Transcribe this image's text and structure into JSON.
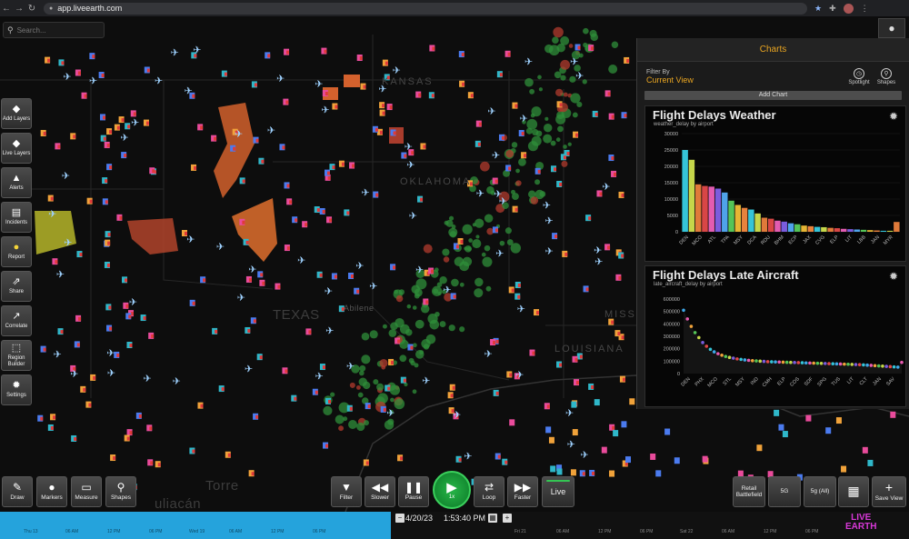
{
  "browser": {
    "url": "app.liveearth.com"
  },
  "search": {
    "placeholder": "Search..."
  },
  "map_labels": [
    "KANSAS",
    "OKLAHOMA",
    "TEXAS",
    "MISS",
    "LOUISIANA",
    "Torre",
    "uliacán",
    "Abilene"
  ],
  "sidebar": {
    "items": [
      {
        "label": "Add Layers",
        "icon": "layers-icon"
      },
      {
        "label": "Live Layers",
        "icon": "live-layers-icon"
      },
      {
        "label": "Alerts",
        "icon": "alert-icon"
      },
      {
        "label": "Incidents",
        "icon": "incidents-icon"
      },
      {
        "label": "Report",
        "icon": "report-pin-icon"
      },
      {
        "label": "Share",
        "icon": "share-icon"
      },
      {
        "label": "Correlate",
        "icon": "correlate-icon"
      },
      {
        "label": "Region Builder",
        "icon": "region-builder-icon"
      },
      {
        "label": "Settings",
        "icon": "gear-icon"
      }
    ]
  },
  "panel": {
    "title": "Charts",
    "filter_label": "Filter By",
    "filter_value": "Current View",
    "tools": [
      {
        "label": "Spotlight",
        "icon": "spotlight-icon"
      },
      {
        "label": "Shapes",
        "icon": "shapes-icon"
      }
    ],
    "add_chart": "Add Chart"
  },
  "chart_data": [
    {
      "type": "bar",
      "title": "Flight Delays Weather",
      "subtitle": "weather_delay by airport",
      "ylim": [
        0,
        30000
      ],
      "yticks": [
        "30000",
        "25000",
        "20000",
        "15000",
        "10000",
        "5000",
        "0"
      ],
      "categories": [
        "DEN",
        "",
        "MCO",
        "",
        "ATL",
        "",
        "TPA",
        "",
        "MSY",
        "",
        "DCA",
        "",
        "RDU",
        "",
        "BHM",
        "",
        "ECP",
        "",
        "JAX",
        "",
        "CVG",
        "",
        "ELP",
        "",
        "LIT",
        "",
        "LBB",
        "",
        "JAN",
        "",
        "MYR",
        "",
        ""
      ],
      "xtick_labels": [
        "DEN",
        "MCO",
        "ATL",
        "TPA",
        "MSY",
        "DCA",
        "RDU",
        "BHM",
        "ECP",
        "JAX",
        "CVG",
        "ELP",
        "LIT",
        "LBB",
        "JAN",
        "MYR"
      ],
      "values": [
        25000,
        22000,
        14500,
        14000,
        13800,
        13200,
        12000,
        9500,
        8200,
        7300,
        6800,
        5600,
        4300,
        4000,
        3400,
        3100,
        2600,
        2300,
        1900,
        1700,
        1500,
        1400,
        1200,
        1100,
        900,
        800,
        700,
        600,
        500,
        400,
        300,
        300,
        3000
      ]
    },
    {
      "type": "scatter",
      "title": "Flight Delays Late Aircraft",
      "subtitle": "late_aircraft_delay by airport",
      "ylim": [
        0,
        600000
      ],
      "yticks": [
        "600000",
        "500000",
        "400000",
        "300000",
        "200000",
        "100000",
        "0"
      ],
      "xtick_labels": [
        "DEN",
        "PHX",
        "MCO",
        "STL",
        "MSY",
        "IND",
        "CMH",
        "ELP",
        "COS",
        "SDF",
        "SPG",
        "TUS",
        "LIT",
        "CLT",
        "JAN",
        "SAV"
      ],
      "values": [
        510000,
        440000,
        380000,
        330000,
        290000,
        250000,
        220000,
        195000,
        175000,
        160000,
        148000,
        138000,
        130000,
        124000,
        118000,
        114000,
        110000,
        107000,
        104000,
        102000,
        100000,
        98000,
        96000,
        95000,
        94000,
        93000,
        92000,
        91000,
        90000,
        89000,
        88000,
        87000,
        86000,
        85000,
        84000,
        83000,
        82000,
        81000,
        80000,
        79000,
        78000,
        77000,
        76000,
        75000,
        74000,
        73000,
        72000,
        70000,
        68000,
        66000,
        64000,
        62000,
        60000,
        58000,
        56000,
        54000,
        52000,
        90000
      ]
    }
  ],
  "toolbar": {
    "left": [
      {
        "label": "Draw",
        "icon": "pencil-icon"
      },
      {
        "label": "Markers",
        "icon": "marker-pin-icon"
      },
      {
        "label": "Measure",
        "icon": "ruler-icon"
      },
      {
        "label": "Shapes",
        "icon": "shapes-icon"
      }
    ],
    "playback": [
      {
        "label": "Filter",
        "icon": "filter-icon"
      },
      {
        "label": "Slower",
        "icon": "rewind-icon"
      },
      {
        "label": "Pause",
        "icon": "pause-icon"
      }
    ],
    "play": {
      "label": "1x",
      "icon": "play-icon"
    },
    "playback_right": [
      {
        "label": "Loop",
        "icon": "loop-icon"
      },
      {
        "label": "Faster",
        "icon": "fast-forward-icon"
      }
    ],
    "live": "Live",
    "right": [
      {
        "label": "Retail Battlefield"
      },
      {
        "label": "5G"
      },
      {
        "label": "5g (All)"
      },
      {
        "label": "",
        "icon": "grid-icon"
      },
      {
        "label": "Save View",
        "icon": "plus-icon"
      }
    ]
  },
  "timeline": {
    "date": "4/20/23",
    "time": "1:53:40 PM",
    "ticks_left": [
      "Thu 13",
      "06 AM",
      "12 PM",
      "06 PM",
      "Wed 19",
      "06 AM",
      "12 PM",
      "06 PM"
    ],
    "ticks_right": [
      "Fri 21",
      "06 AM",
      "12 PM",
      "06 PM",
      "Sat 22",
      "06 AM",
      "12 PM",
      "06 PM"
    ]
  },
  "logo": {
    "line1": "LIVE",
    "line2": "EARTH"
  }
}
